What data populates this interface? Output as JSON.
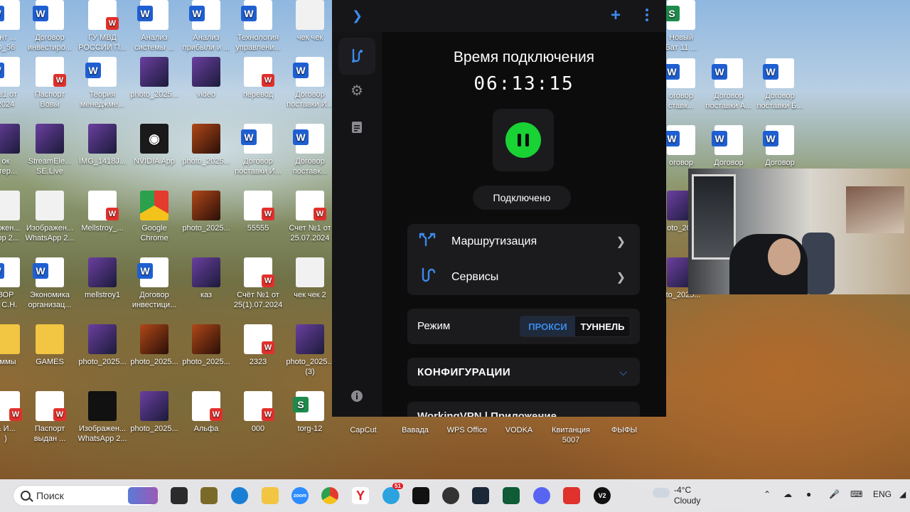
{
  "desktop_icons": [
    {
      "label": "ент ...\nD_56",
      "type": "word",
      "col": 0,
      "row": 0
    },
    {
      "label": "Договор\nинвестиро...",
      "type": "word",
      "col": 1,
      "row": 0
    },
    {
      "label": "ГУ МВД\nРОССИИ П...",
      "type": "pdf",
      "col": 2,
      "row": 0
    },
    {
      "label": "Анализ\nсистемы ...",
      "type": "word",
      "col": 3,
      "row": 0
    },
    {
      "label": "Анализ\nприбыли и ...",
      "type": "word",
      "col": 4,
      "row": 0
    },
    {
      "label": "Технология\nуправлени...",
      "type": "word",
      "col": 5,
      "row": 0
    },
    {
      "label": "чек чек",
      "type": "doc",
      "col": 6,
      "row": 0
    },
    {
      "label": "№1 от\n2024",
      "type": "word",
      "col": 0,
      "row": 1
    },
    {
      "label": "Паспорт\nВовы",
      "type": "pdf",
      "col": 1,
      "row": 1
    },
    {
      "label": "Теория\nменеджме...",
      "type": "word",
      "col": 2,
      "row": 1
    },
    {
      "label": "photo_2025...",
      "type": "img",
      "col": 3,
      "row": 1
    },
    {
      "label": "video",
      "type": "img",
      "col": 4,
      "row": 1
    },
    {
      "label": "перевод",
      "type": "pdf",
      "col": 5,
      "row": 1
    },
    {
      "label": "Договор\nпоставки И...",
      "type": "word",
      "col": 6,
      "row": 1
    },
    {
      "label": "ок\nотер...",
      "type": "img",
      "col": 0,
      "row": 2
    },
    {
      "label": "StreamEle...\nSE.Live",
      "type": "img",
      "col": 1,
      "row": 2
    },
    {
      "label": "IMG_1418J...",
      "type": "img",
      "col": 2,
      "row": 2
    },
    {
      "label": "NVIDIA App",
      "type": "nvidia",
      "col": 3,
      "row": 2
    },
    {
      "label": "photo_2025...",
      "type": "img2",
      "col": 4,
      "row": 2
    },
    {
      "label": "Договор\nпоставки И...",
      "type": "word",
      "col": 5,
      "row": 2
    },
    {
      "label": "Договор\nпоставк...",
      "type": "word",
      "col": 6,
      "row": 2
    },
    {
      "label": "ражен...\nApp 2...",
      "type": "doc",
      "col": 0,
      "row": 3
    },
    {
      "label": "Изображен...\nWhatsApp 2...",
      "type": "doc",
      "col": 1,
      "row": 3
    },
    {
      "label": "Mellstroy_...",
      "type": "pdf",
      "col": 2,
      "row": 3
    },
    {
      "label": "Google\nChrome",
      "type": "chrome",
      "col": 3,
      "row": 3
    },
    {
      "label": "photo_2025...",
      "type": "img2",
      "col": 4,
      "row": 3
    },
    {
      "label": "55555",
      "type": "pdf",
      "col": 5,
      "row": 3
    },
    {
      "label": "Счет №1 от\n25.07.2024",
      "type": "pdf",
      "col": 6,
      "row": 3
    },
    {
      "label": "ВОР\nА С.Н.",
      "type": "word",
      "col": 0,
      "row": 4
    },
    {
      "label": "Экономика\nорганизац...",
      "type": "word",
      "col": 1,
      "row": 4
    },
    {
      "label": "mellstroy1",
      "type": "img",
      "col": 2,
      "row": 4
    },
    {
      "label": "Договор\nинвестици...",
      "type": "word",
      "col": 3,
      "row": 4
    },
    {
      "label": "каз",
      "type": "img",
      "col": 4,
      "row": 4
    },
    {
      "label": "Счёт №1 от\n25(1).07.2024",
      "type": "pdf",
      "col": 5,
      "row": 4
    },
    {
      "label": "чек чек 2",
      "type": "doc",
      "col": 6,
      "row": 4
    },
    {
      "label": "аммы",
      "type": "folder",
      "col": 0,
      "row": 5
    },
    {
      "label": "GAMES",
      "type": "folder",
      "col": 1,
      "row": 5
    },
    {
      "label": "photo_2025...",
      "type": "img",
      "col": 2,
      "row": 5
    },
    {
      "label": "photo_2025...",
      "type": "img2",
      "col": 3,
      "row": 5
    },
    {
      "label": "photo_2025...",
      "type": "img2",
      "col": 4,
      "row": 5
    },
    {
      "label": "2323",
      "type": "pdf",
      "col": 5,
      "row": 5
    },
    {
      "label": "photo_2025...\n(3)",
      "type": "img",
      "col": 6,
      "row": 5
    },
    {
      "label": "& И...\n)",
      "type": "pdf",
      "col": 0,
      "row": 6
    },
    {
      "label": "Паспорт\nвыдан ...",
      "type": "pdf",
      "col": 1,
      "row": 6
    },
    {
      "label": "Изображен...\nWhatsApp 2...",
      "type": "dark",
      "col": 2,
      "row": 6
    },
    {
      "label": "photo_2025...",
      "type": "img",
      "col": 3,
      "row": 6
    },
    {
      "label": "Альфа",
      "type": "pdf",
      "col": 4,
      "row": 6
    },
    {
      "label": "000",
      "type": "pdf",
      "col": 5,
      "row": 6
    },
    {
      "label": "torg-12",
      "type": "excel",
      "col": 6,
      "row": 6
    }
  ],
  "desktop_icons_right": [
    {
      "label": "Новый\nБат 11 ...",
      "type": "excel",
      "col": 0,
      "row": 0
    },
    {
      "label": "оговор\nставк...",
      "type": "word",
      "col": 0,
      "row": 1
    },
    {
      "label": "Договор\nпоставки А...",
      "type": "word",
      "col": 1,
      "row": 1
    },
    {
      "label": "Договор\nпоставки Б...",
      "type": "word",
      "col": 2,
      "row": 1
    },
    {
      "label": "оговор",
      "type": "word",
      "col": 0,
      "row": 2
    },
    {
      "label": "Договор",
      "type": "word",
      "col": 1,
      "row": 2
    },
    {
      "label": "Договор",
      "type": "word",
      "col": 2,
      "row": 2
    },
    {
      "label": "oto_202",
      "type": "img",
      "col": 0,
      "row": 3
    },
    {
      "label": "oto_2025...",
      "type": "img",
      "col": 0,
      "row": 4
    }
  ],
  "desktop_icons_bottom": [
    {
      "label": "CapCut"
    },
    {
      "label": "Вавада"
    },
    {
      "label": "WPS Office"
    },
    {
      "label": "VODKA"
    },
    {
      "label": "Квитанция\n5007"
    },
    {
      "label": "ФЫФЫ"
    }
  ],
  "vpn": {
    "connection_title": "Время подключения",
    "timer": "06:13:15",
    "status": "Подключено",
    "menu": [
      {
        "label": "Маршрутизация",
        "icon": "routing-icon"
      },
      {
        "label": "Сервисы",
        "icon": "services-icon"
      }
    ],
    "mode_label": "Режим",
    "mode_options": [
      "ПРОКСИ",
      "ТУННЕЛЬ"
    ],
    "mode_selected": "ПРОКСИ",
    "configurations_label": "КОНФИГУРАЦИИ",
    "config_peek": "WorkingVPN | Приложение",
    "accent_color": "#3b8bea",
    "connected_color": "#19d234"
  },
  "taskbar": {
    "search_placeholder": "Поиск",
    "weather_temp": "-4°C",
    "weather_desc": "Cloudy",
    "language": "ENG",
    "telegram_badge": "51"
  }
}
